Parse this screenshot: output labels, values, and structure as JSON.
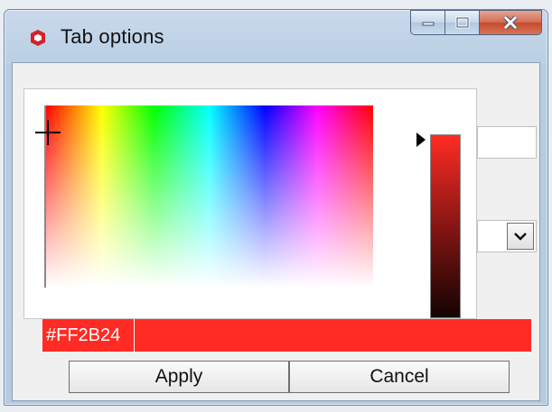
{
  "window": {
    "title": "Tab options",
    "icons": {
      "app": "sketchup-icon",
      "minimize": "minimize-icon",
      "maximize": "maximize-icon",
      "close": "close-icon"
    }
  },
  "picker": {
    "hex_value": "#FF2B24",
    "accent_color": "#FF2B24",
    "dropdown_icon": "chevron-down-icon"
  },
  "buttons": {
    "apply_label": "Apply",
    "cancel_label": "Cancel"
  }
}
